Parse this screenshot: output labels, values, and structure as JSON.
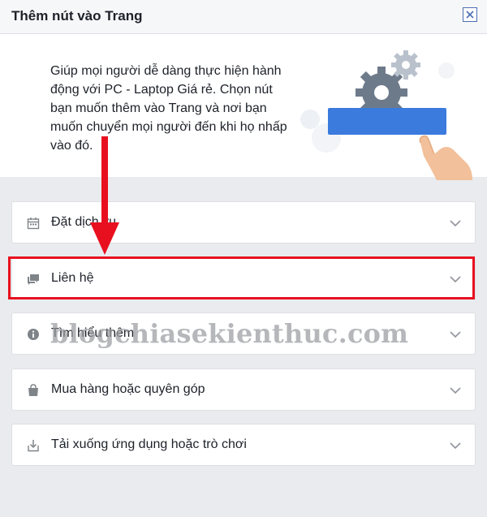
{
  "dialog": {
    "title": "Thêm nút vào Trang",
    "close_icon": "close-icon"
  },
  "intro": {
    "text": "Giúp mọi người dễ dàng thực hiện hành động với PC - Laptop Giá rẻ. Chọn nút bạn muốn thêm vào Trang và nơi bạn muốn chuyển mọi người đến khi họ nhấp vào đó.",
    "illustration_icon": "gears-hand-button-illustration"
  },
  "options": [
    {
      "label": "Đặt dịch vụ",
      "icon": "calendar-icon",
      "highlighted": false
    },
    {
      "label": "Liên hệ",
      "icon": "chat-icon",
      "highlighted": true
    },
    {
      "label": "Tìm hiểu thêm",
      "icon": "info-icon",
      "highlighted": false
    },
    {
      "label": "Mua hàng hoặc quyên góp",
      "icon": "shopping-bag-icon",
      "highlighted": false
    },
    {
      "label": "Tải xuống ứng dụng hoặc trò chơi",
      "icon": "download-icon",
      "highlighted": false
    }
  ],
  "annotation": {
    "arrow_color": "#e8101f",
    "highlight_color": "#e8101f",
    "watermark": "blogchiasekienthuc.com"
  },
  "colors": {
    "accent": "#4267b2",
    "background": "#e9ebee"
  }
}
